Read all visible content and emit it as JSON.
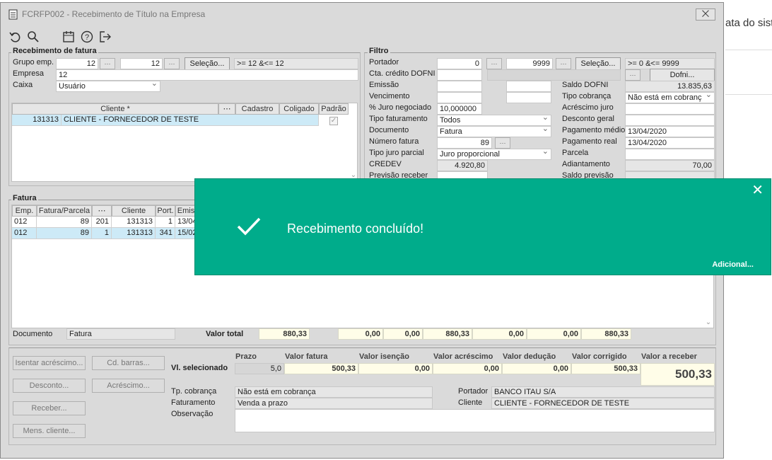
{
  "bg": {
    "text": "ata do sist"
  },
  "window": {
    "title": "FCRFP002 - Recebimento de Título na Empresa",
    "close": "⨉"
  },
  "toolbar": {
    "icons": [
      "undo-icon",
      "search-icon",
      "calendar-icon",
      "help-icon",
      "exit-icon"
    ]
  },
  "receb": {
    "title": "Recebimento de fatura",
    "grupo_label": "Grupo emp.",
    "grupo_from": "12",
    "grupo_to": "12",
    "selecao": "Seleção...",
    "grupo_range": ">= 12 &<= 12",
    "empresa_label": "Empresa",
    "empresa": "12",
    "caixa_label": "Caixa",
    "caixa": "Usuário",
    "grid_headers": [
      "Cliente *",
      "Cadastro",
      "Coligado",
      "Padrão"
    ],
    "grid_row": {
      "code": "131313",
      "name": "CLIENTE - FORNECEDOR DE TESTE"
    }
  },
  "filtro": {
    "title": "Filtro",
    "portador_label": "Portador",
    "portador_from": "0",
    "portador_to": "9999",
    "selecao": "Seleção...",
    "portador_range": ">= 0 &<= 9999",
    "cta_label": "Cta. crédito DOFNI",
    "dofni_btn": "Dofni...",
    "emissao_label": "Emissão",
    "vencimento_label": "Vencimento",
    "juro_label": "% Juro negociado",
    "juro": "10,000000",
    "tipo_fat_label": "Tipo faturamento",
    "tipo_fat": "Todos",
    "documento_label": "Documento",
    "documento": "Fatura",
    "num_fat_label": "Número fatura",
    "num_fat": "89",
    "tipo_juro_label": "Tipo juro parcial",
    "tipo_juro": "Juro proporcional",
    "credev_label": "CREDEV",
    "credev": "4.920,80",
    "prev_label": "Previsão receber",
    "saldo_dofni_label": "Saldo DOFNI",
    "saldo_dofni": "13.835,63",
    "tipo_cob_label": "Tipo cobrança",
    "tipo_cob": "Não está em cobranç",
    "acresc_label": "Acréscimo juro",
    "desc_label": "Desconto geral",
    "pag_medio_label": "Pagamento médio",
    "pag_medio": "13/04/2020",
    "pag_real_label": "Pagamento real",
    "pag_real": "13/04/2020",
    "parcela_label": "Parcela",
    "adiant_label": "Adiantamento",
    "adiant": "70,00",
    "saldo_prev_label": "Saldo previsão"
  },
  "fatura": {
    "title": "Fatura",
    "headers": [
      "Emp.",
      "Fatura/Parcela",
      "Cliente",
      "Port.",
      "Emis"
    ],
    "rows": [
      {
        "emp": "012",
        "fatura": "89",
        "parcela": "201",
        "cliente": "131313",
        "port": "1",
        "emis": "13/04"
      },
      {
        "emp": "012",
        "fatura": "89",
        "parcela": "1",
        "cliente": "131313",
        "port": "341",
        "emis": "15/02"
      }
    ],
    "documento_label": "Documento",
    "documento": "Fatura",
    "valor_total_label": "Valor total",
    "totals": [
      "880,33",
      "0,00",
      "0,00",
      "880,33",
      "0,00",
      "0,00",
      "880,33"
    ]
  },
  "buttons": {
    "isentar": "Isentar acréscimo...",
    "cd_barras": "Cd. barras...",
    "desconto": "Desconto...",
    "acrescimo": "Acréscimo...",
    "receber": "Receber...",
    "mens": "Mens. cliente..."
  },
  "selecionado": {
    "label": "Vl. selecionado",
    "headers": [
      "Prazo",
      "Valor fatura",
      "Valor isenção",
      "Valor acréscimo",
      "Valor dedução",
      "Valor corrigido",
      "Valor a receber"
    ],
    "values": [
      "5,0",
      "500,33",
      "0,00",
      "0,00",
      "0,00",
      "500,33",
      "500,33"
    ]
  },
  "info": {
    "tp_cob_label": "Tp. cobrança",
    "tp_cob": "Não está em cobrança",
    "faturamento_label": "Faturamento",
    "faturamento": "Venda a prazo",
    "obs_label": "Observação",
    "portador_label": "Portador",
    "portador": "BANCO ITAU S/A",
    "cliente_label": "Cliente",
    "cliente": "CLIENTE - FORNECEDOR DE TESTE"
  },
  "toast": {
    "message": "Recebimento concluído!",
    "additional": "Adicional...",
    "close": "✕"
  }
}
